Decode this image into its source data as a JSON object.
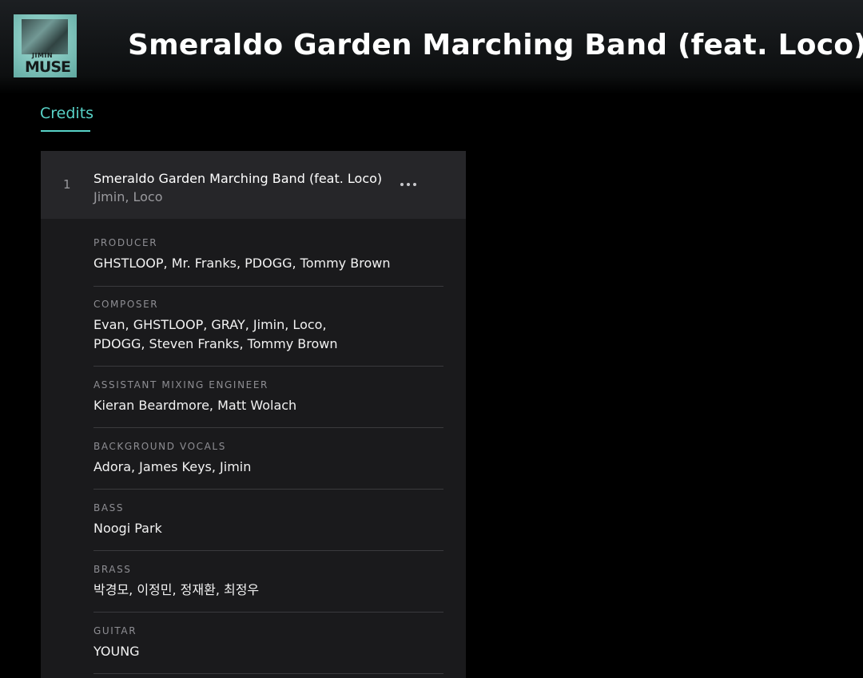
{
  "header": {
    "album_artist": "JIMIN",
    "album_title": "MUSE",
    "track_title": "Smeraldo Garden Marching Band (feat. Loco)"
  },
  "tabs": [
    {
      "label": "Credits",
      "active": true
    }
  ],
  "track": {
    "number": "1",
    "title": "Smeraldo Garden Marching Band (feat. Loco)",
    "artists": "Jimin, Loco",
    "more_icon": "more-horizontal-icon"
  },
  "credits": [
    {
      "role": "PRODUCER",
      "names": "GHSTLOOP, Mr. Franks, PDOGG, Tommy Brown"
    },
    {
      "role": "COMPOSER",
      "names": "Evan, GHSTLOOP, GRAY, Jimin, Loco,\nPDOGG, Steven Franks, Tommy Brown"
    },
    {
      "role": "ASSISTANT MIXING ENGINEER",
      "names": "Kieran Beardmore, Matt Wolach"
    },
    {
      "role": "BACKGROUND VOCALS",
      "names": "Adora, James Keys, Jimin"
    },
    {
      "role": "BASS",
      "names": "Noogi Park"
    },
    {
      "role": "BRASS",
      "names": "박경모, 이정민, 정재환, 최정우"
    },
    {
      "role": "GUITAR",
      "names": "YOUNG"
    }
  ],
  "colors": {
    "accent": "#58d3c8",
    "background": "#000000",
    "panel": "#1a1a1c",
    "track_row": "#262629"
  }
}
